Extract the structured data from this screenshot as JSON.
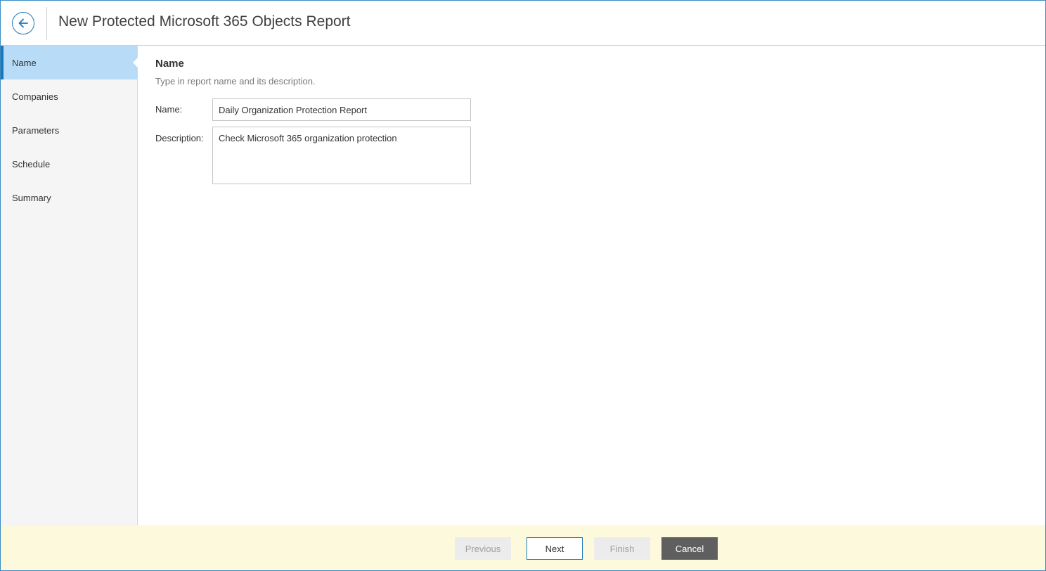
{
  "header": {
    "title": "New Protected Microsoft 365 Objects Report",
    "back_icon": "arrow-left-circle-icon"
  },
  "sidebar": {
    "items": [
      {
        "label": "Name",
        "active": true
      },
      {
        "label": "Companies",
        "active": false
      },
      {
        "label": "Parameters",
        "active": false
      },
      {
        "label": "Schedule",
        "active": false
      },
      {
        "label": "Summary",
        "active": false
      }
    ]
  },
  "main": {
    "section_title": "Name",
    "section_description": "Type in report name and its description.",
    "name_label": "Name:",
    "name_value": "Daily Organization Protection Report",
    "description_label": "Description:",
    "description_value": "Check Microsoft 365 organization protection"
  },
  "footer": {
    "previous_label": "Previous",
    "next_label": "Next",
    "finish_label": "Finish",
    "cancel_label": "Cancel"
  },
  "colors": {
    "accent": "#1a78b8",
    "sidebar_active": "#b8dcf7",
    "footer_bg": "#fdf9dc",
    "cancel_bg": "#5f5f5f"
  }
}
